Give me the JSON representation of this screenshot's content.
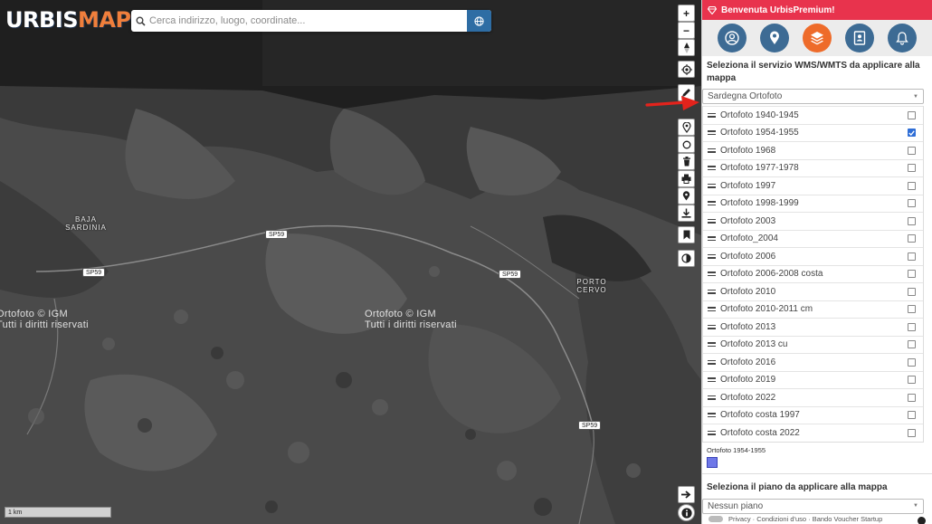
{
  "app": {
    "logo_part1": "URBIS",
    "logo_part2": "MAP"
  },
  "search": {
    "placeholder": "Cerca indirizzo, luogo, coordinate...",
    "icon": "search-icon",
    "action_icon": "globe-icon"
  },
  "map": {
    "place_labels": [
      "BAJA SARDINIA",
      "PORTO CERVO"
    ],
    "road_labels": [
      "SP59",
      "SP59",
      "SP59",
      "SP59"
    ],
    "watermark_line1": "Ortofoto © IGM",
    "watermark_line2": "Tutti i diritti riservati",
    "scale_label": "1 km"
  },
  "toolbar": {
    "zoom_in": "+",
    "zoom_out": "−",
    "icons": [
      "compass-icon",
      "locate-icon",
      "pencil-icon",
      "marker-icon",
      "circle-icon",
      "trash-icon",
      "print-icon",
      "pin-icon",
      "download-icon",
      "bookmark-icon",
      "contrast-icon",
      "arrow-right-icon",
      "info-icon"
    ]
  },
  "panel": {
    "header": "Benvenuta UrbisPremium!",
    "header_icon": "diamond-icon",
    "nav_icons": [
      "user-icon",
      "map-pin-icon",
      "layers-icon",
      "contact-card-icon",
      "bell-icon"
    ],
    "active_nav": "layers-icon",
    "service_title": "Seleziona il servizio WMS/WMTS da applicare alla mappa",
    "service_selected": "Sardegna Ortofoto",
    "layers": [
      {
        "name": "Ortofoto 1940-1945",
        "checked": false
      },
      {
        "name": "Ortofoto 1954-1955",
        "checked": true
      },
      {
        "name": "Ortofoto 1968",
        "checked": false
      },
      {
        "name": "Ortofoto 1977-1978",
        "checked": false
      },
      {
        "name": "Ortofoto 1997",
        "checked": false
      },
      {
        "name": "Ortofoto 1998-1999",
        "checked": false
      },
      {
        "name": "Ortofoto 2003",
        "checked": false
      },
      {
        "name": "Ortofoto_2004",
        "checked": false
      },
      {
        "name": "Ortofoto 2006",
        "checked": false
      },
      {
        "name": "Ortofoto 2006-2008 costa",
        "checked": false
      },
      {
        "name": "Ortofoto 2010",
        "checked": false
      },
      {
        "name": "Ortofoto 2010-2011 cm",
        "checked": false
      },
      {
        "name": "Ortofoto 2013",
        "checked": false
      },
      {
        "name": "Ortofoto 2013 cu",
        "checked": false
      },
      {
        "name": "Ortofoto 2016",
        "checked": false
      },
      {
        "name": "Ortofoto 2019",
        "checked": false
      },
      {
        "name": "Ortofoto 2022",
        "checked": false
      },
      {
        "name": "Ortofoto costa 1997",
        "checked": false
      },
      {
        "name": "Ortofoto costa 2022",
        "checked": false
      }
    ],
    "legend_title": "Ortofoto 1954-1955",
    "legend_color": "#6f78e8",
    "plan_title": "Seleziona il piano da applicare alla mappa",
    "plan_selected": "Nessun piano",
    "footer_text": "Privacy · Condizioni d'uso · Bando Voucher Startup"
  },
  "colors": {
    "header_red": "#e8334d",
    "nav_blue": "#3d6b94",
    "nav_active_orange": "#ee6b2a",
    "checkbox_blue": "#2f6ed6",
    "annotation_red": "#e3231c"
  }
}
